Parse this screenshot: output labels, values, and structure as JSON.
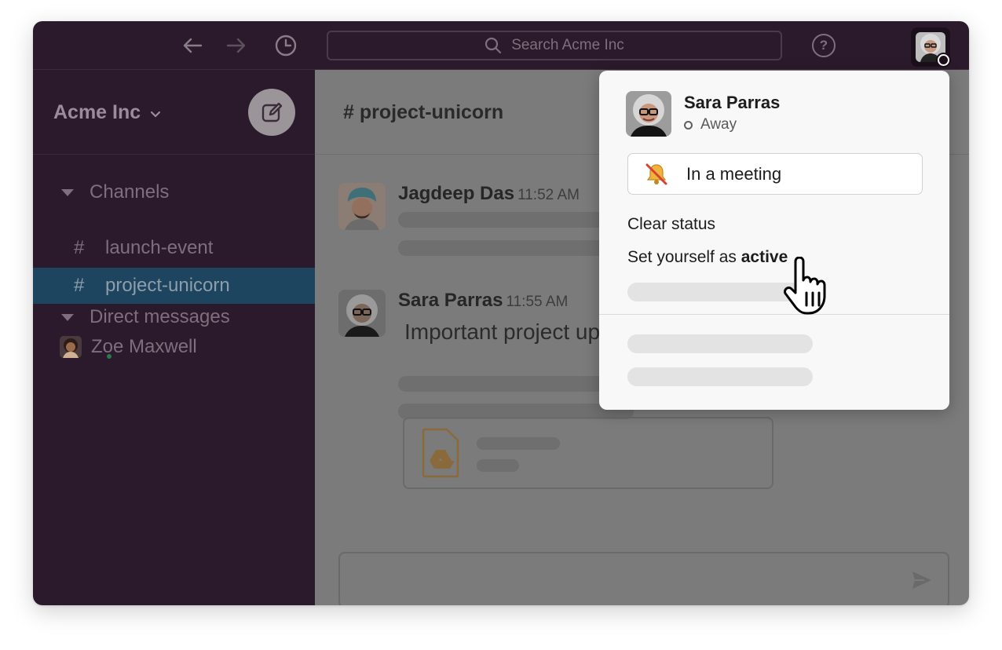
{
  "topbar": {
    "back_icon": "arrow-left-icon",
    "forward_icon": "arrow-right-icon",
    "history_icon": "clock-icon",
    "search_placeholder": "Search Acme Inc",
    "help_label": "?",
    "avatar_icon": "user-avatar-icon"
  },
  "sidebar": {
    "workspace_name": "Acme Inc",
    "channels_heading": "Channels",
    "channels": [
      {
        "hash": "#",
        "label": "launch-event",
        "active": false
      },
      {
        "hash": "#",
        "label": "project-unicorn",
        "active": true
      }
    ],
    "dms_heading": "Direct messages",
    "dms": [
      {
        "label": "Zoe Maxwell",
        "presence": "active"
      }
    ]
  },
  "channel": {
    "title": "# project-unicorn"
  },
  "messages": [
    {
      "author": "Jagdeep Das",
      "time": "11:52 AM",
      "text": ""
    },
    {
      "author": "Sara Parras",
      "time": "11:55 AM",
      "text": "Important project up"
    }
  ],
  "popup": {
    "user_name": "Sara Parras",
    "presence": "Away",
    "status_text": "In a meeting",
    "status_emoji": "bell-with-slash",
    "clear_status": "Clear status",
    "set_active_prefix": "Set yourself as ",
    "set_active_bold": "active"
  },
  "colors": {
    "sidebar_bg": "#2a1a2c",
    "topbar_bg": "#2b1a2b",
    "active_channel": "#1e4560",
    "popup_bg": "#f8f8f8",
    "file_icon": "#e8a33a"
  }
}
